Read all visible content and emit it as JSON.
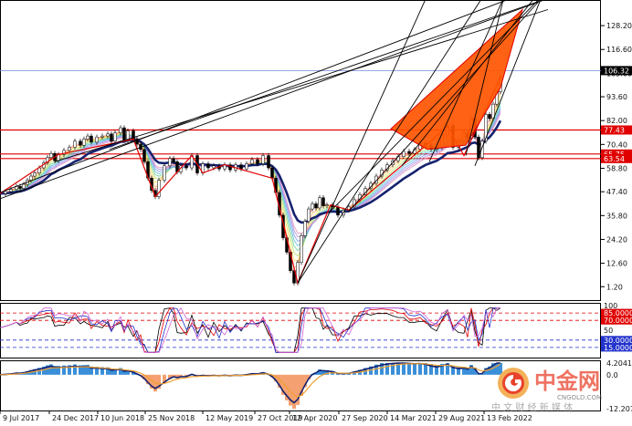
{
  "chart_data": [
    {
      "type": "line",
      "panel": "main-price",
      "title": "",
      "xlabel": "",
      "ylabel": "",
      "ylim": [
        -4,
        138
      ],
      "grid": false,
      "x_tick_labels": [
        "9 Jul 2017",
        "24 Dec 2017",
        "10 Jun 2018",
        "25 Nov 2018",
        "12 May 2019",
        "27 Oct 2019",
        "12 Apr 2020",
        "27 Sep 2020",
        "14 Mar 2021",
        "29 Aug 2021",
        "13 Feb 2022"
      ],
      "y_tick_labels": [
        "128.20",
        "116.60",
        "105.00",
        "93.60",
        "82.00",
        "70.40",
        "58.80",
        "47.40",
        "35.80",
        "24.20",
        "12.60",
        "1.20"
      ],
      "y_tick_values": [
        128.2,
        116.6,
        105.0,
        93.6,
        82.0,
        70.4,
        58.8,
        47.4,
        35.8,
        24.2,
        12.6,
        1.2
      ],
      "price_labels": [
        {
          "text": "106.32",
          "value": 106.32,
          "color": "#000000",
          "text_color": "#ffffff"
        },
        {
          "text": "77.43",
          "value": 77.43,
          "color": "#e00000",
          "text_color": "#ffffff"
        },
        {
          "text": "65.75",
          "value": 65.75,
          "color": "#e00000",
          "text_color": "#ffffff"
        },
        {
          "text": "63.54",
          "value": 63.54,
          "color": "#e00000",
          "text_color": "#ffffff"
        }
      ],
      "horizontal_lines": [
        {
          "value": 77.43,
          "color": "#e00000"
        },
        {
          "value": 65.75,
          "color": "#e00000"
        },
        {
          "value": 63.54,
          "color": "#e00000"
        },
        {
          "value": 106.32,
          "color": "#7788dd"
        }
      ],
      "series": [
        {
          "kind": "price",
          "x": [
            0,
            6,
            12,
            18,
            22,
            26,
            30,
            34,
            38,
            43,
            48,
            52,
            56,
            60,
            64,
            70,
            76,
            82,
            88,
            92,
            96,
            100,
            106,
            112,
            118,
            122,
            126,
            132,
            136,
            140,
            146,
            150,
            154,
            158,
            162,
            166,
            170,
            174,
            180,
            186,
            190,
            194,
            198,
            204,
            210,
            216,
            222,
            228,
            234,
            240,
            246,
            252,
            258,
            264,
            270,
            276,
            282,
            288,
            294,
            298,
            302,
            306,
            310,
            314,
            318,
            322,
            326,
            330,
            334,
            338,
            342,
            346,
            350,
            354,
            358,
            364,
            370,
            376,
            382,
            388,
            394,
            400,
            406,
            412,
            418,
            424,
            430,
            436,
            442,
            448,
            454,
            460,
            466,
            472,
            478,
            484,
            490,
            496,
            502,
            508,
            512,
            516,
            520,
            524,
            528,
            532,
            536,
            540,
            544,
            548
          ],
          "values": [
            46.5,
            47.5,
            48.5,
            50.0,
            49.0,
            51.0,
            53.0,
            55.0,
            56.5,
            59.0,
            61.5,
            64.0,
            66.0,
            62.5,
            65.5,
            67.5,
            69.0,
            72.0,
            70.0,
            73.0,
            74.5,
            71.5,
            74.0,
            74.5,
            75.5,
            72.0,
            76.0,
            78.5,
            72.5,
            77.0,
            73.0,
            70.5,
            68.0,
            62.0,
            54.0,
            48.0,
            45.0,
            53.0,
            60.0,
            63.5,
            62.0,
            57.0,
            60.0,
            59.0,
            65.0,
            56.5,
            61.0,
            59.0,
            60.0,
            58.5,
            60.5,
            58.0,
            60.5,
            58.5,
            61.0,
            63.0,
            61.0,
            65.0,
            59.0,
            54.0,
            47.0,
            36.0,
            25.0,
            18.0,
            9.0,
            3.0,
            13.0,
            26.0,
            33.0,
            39.0,
            41.5,
            39.5,
            44.5,
            40.5,
            41.0,
            40.0,
            36.0,
            38.5,
            40.0,
            43.5,
            46.0,
            49.0,
            51.5,
            55.0,
            58.0,
            60.5,
            62.5,
            64.5,
            67.0,
            66.0,
            68.0,
            71.0,
            70.0,
            68.0,
            69.0,
            75.0,
            79.5,
            69.0,
            72.0,
            76.0,
            73.5,
            83.0,
            74.0,
            64.0,
            72.0,
            85.0,
            83.0,
            90.0,
            96.0,
            103.0
          ]
        }
      ]
    },
    {
      "type": "line",
      "panel": "oscillator",
      "title": "",
      "ylim": [
        0,
        100
      ],
      "y_tick_labels": [
        "100",
        "85.0000",
        "70.0000",
        "50",
        "30.0000",
        "15.0000"
      ],
      "y_tick_values": [
        100,
        85,
        70,
        50,
        30,
        15
      ],
      "levels": [
        {
          "value": 85,
          "color": "#e00000",
          "text_color": "#ffffff"
        },
        {
          "value": 70,
          "color": "#e00000",
          "text_color": "#ffffff"
        },
        {
          "value": 30,
          "color": "#2233cc",
          "text_color": "#ffffff"
        },
        {
          "value": 15,
          "color": "#2233cc",
          "text_color": "#ffffff"
        }
      ]
    },
    {
      "type": "bar",
      "panel": "histogram",
      "title": "",
      "y_tick_labels": [
        "4.2041",
        "0.0",
        "-12.2076"
      ],
      "y_tick_values": [
        4.2041,
        0.0,
        -12.2076
      ]
    }
  ],
  "watermark": {
    "title": "中金网",
    "url": "CNGOLD.COM",
    "subtitle": "中 文 财 经 新 媒 体",
    "accent": "#e8432c"
  },
  "colors": {
    "pattern_fill": "#ff5500",
    "support_line": "#e00000",
    "current_price_line": "#7788dd",
    "slow_ma": "#16226e",
    "trendline": "#000000"
  }
}
